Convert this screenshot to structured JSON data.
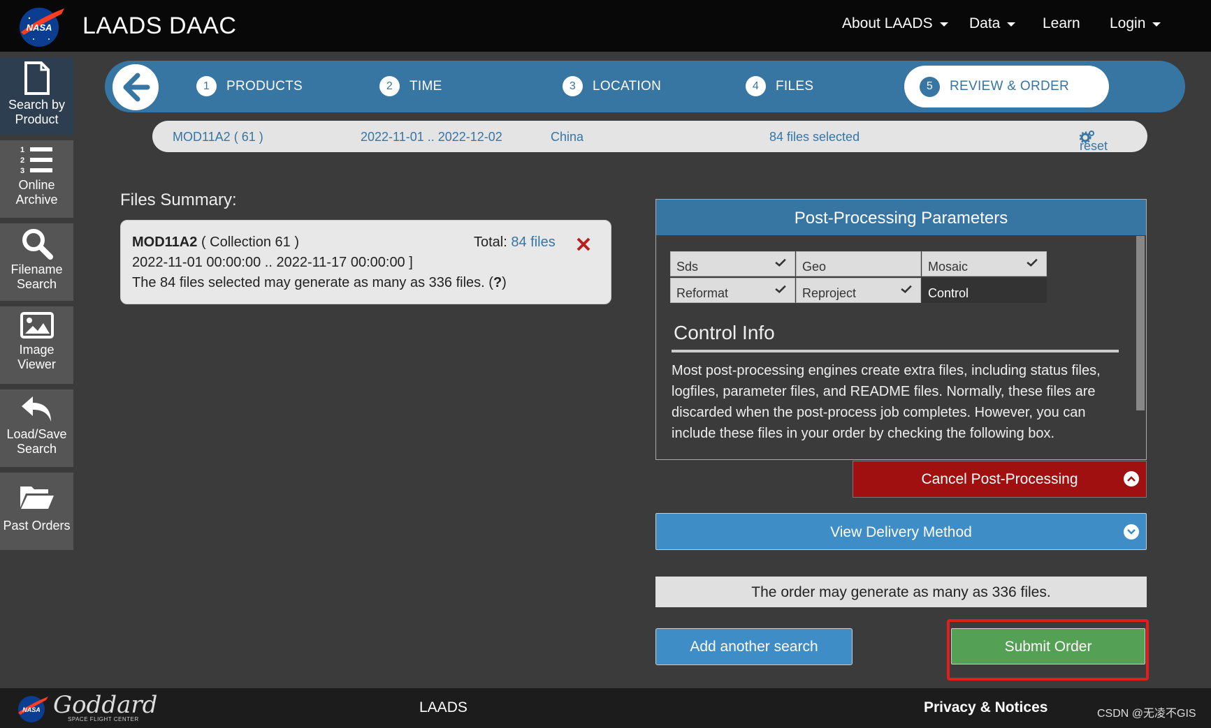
{
  "header": {
    "title": "LAADS DAAC",
    "nav": [
      {
        "label": "About LAADS",
        "dropdown": true
      },
      {
        "label": "Data",
        "dropdown": true
      },
      {
        "label": "Learn",
        "dropdown": false
      },
      {
        "label": "Login",
        "dropdown": true
      }
    ]
  },
  "sidebar": {
    "items": [
      {
        "line1": "Search by",
        "line2": "Product",
        "icon": "document-icon"
      },
      {
        "line1": "Online",
        "line2": "Archive",
        "icon": "numbered-list-icon"
      },
      {
        "line1": "Filename",
        "line2": "Search",
        "icon": "search-icon"
      },
      {
        "line1": "Image",
        "line2": "Viewer",
        "icon": "image-icon"
      },
      {
        "line1": "Load/Save",
        "line2": "Search",
        "icon": "undo-arrow-icon"
      },
      {
        "line1": "Past Orders",
        "line2": "",
        "icon": "folder-open-icon"
      }
    ]
  },
  "stepper": {
    "steps": [
      {
        "num": "1",
        "label": "PRODUCTS"
      },
      {
        "num": "2",
        "label": "TIME"
      },
      {
        "num": "3",
        "label": "LOCATION"
      },
      {
        "num": "4",
        "label": "FILES"
      },
      {
        "num": "5",
        "label": "REVIEW & ORDER"
      }
    ],
    "active": 5
  },
  "summary_strip": {
    "product": "MOD11A2 ( 61 )",
    "time": "2022-11-01 .. 2022-12-02",
    "location": "China",
    "files": "84 files selected",
    "reset": "reset"
  },
  "files_summary": {
    "title": "Files Summary:",
    "product_name": "MOD11A2",
    "collection": "( Collection 61 )",
    "total_label": "Total:",
    "total_link": "84 files",
    "range": "2022-11-01 00:00:00 .. 2022-11-17 00:00:00 ]",
    "note": "The 84 files selected may generate as many as 336 files. (",
    "note_q": "?",
    "note_end": ")"
  },
  "post_processing": {
    "title": "Post-Processing Parameters",
    "tabs": [
      {
        "label": "Sds",
        "checked": true
      },
      {
        "label": "Geo",
        "checked": false
      },
      {
        "label": "Mosaic",
        "checked": true
      },
      {
        "label": "Reformat",
        "checked": true
      },
      {
        "label": "Reproject",
        "checked": true
      },
      {
        "label": "Control",
        "checked": false
      }
    ],
    "selected_tab": "Control",
    "section_title": "Control Info",
    "section_text": "Most post-processing engines create extra files, including status files, logfiles, parameter files, and README files. Normally, these files are discarded when the post-process job completes. However, you can include these files in your order by checking the following box.",
    "cancel_label": "Cancel Post-Processing"
  },
  "delivery": {
    "label": "View Delivery Method"
  },
  "order_note": "The order may generate as many as 336 files.",
  "actions": {
    "add_search": "Add another search",
    "submit": "Submit Order"
  },
  "footer": {
    "logo_script": "Goddard",
    "logo_sub": "SPACE FLIGHT CENTER",
    "laads": "LAADS",
    "privacy": "Privacy & Notices",
    "credit": "CSDN @无凌不GIS"
  },
  "colors": {
    "brand_blue": "#3775a3",
    "button_blue": "#3e8dc7",
    "cancel_red": "#a01010",
    "submit_green": "#54a055",
    "highlight_red": "#e01e1e"
  }
}
